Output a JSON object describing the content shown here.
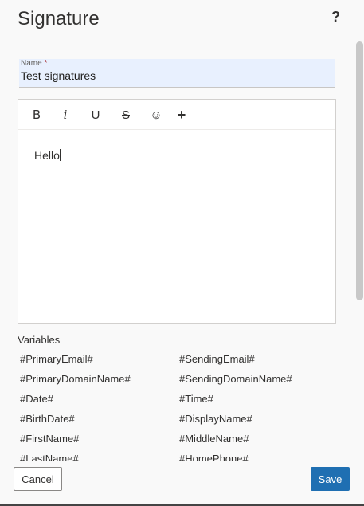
{
  "header": {
    "title": "Signature",
    "help_label": "?"
  },
  "name_field": {
    "label": "Name",
    "required_mark": "*",
    "value": "Test signatures"
  },
  "toolbar": {
    "bold": "B",
    "italic": "i",
    "underline": "U",
    "strikethrough": "S",
    "emoji": "☺",
    "more": "+"
  },
  "editor": {
    "content": "Hello"
  },
  "variables": {
    "label": "Variables",
    "items": [
      "#PrimaryEmail#",
      "#SendingEmail#",
      "#PrimaryDomainName#",
      "#SendingDomainName#",
      "#Date#",
      "#Time#",
      "#BirthDate#",
      "#DisplayName#",
      "#FirstName#",
      "#MiddleName#",
      "#LastName#",
      "#HomePhone#"
    ]
  },
  "footer": {
    "cancel_label": "Cancel",
    "save_label": "Save"
  },
  "colors": {
    "accent": "#1f6fb2",
    "field_bg": "#e8f0fe",
    "panel_bg": "#f9f9f9"
  }
}
